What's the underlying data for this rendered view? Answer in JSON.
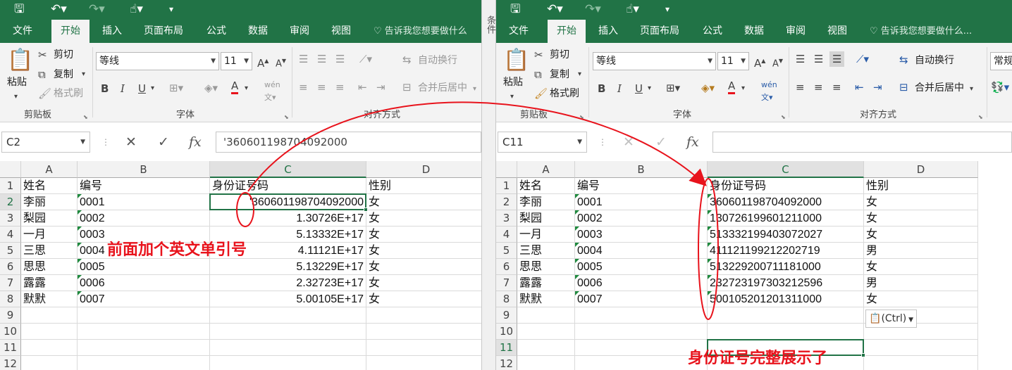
{
  "colors": {
    "excel_green": "#217346",
    "annotation_red": "#e8131c"
  },
  "left": {
    "quick_access": [
      "save-icon",
      "undo-icon",
      "redo-icon",
      "touch-mode-icon",
      "customize-icon"
    ],
    "tabs": [
      "文件",
      "开始",
      "插入",
      "页面布局",
      "公式",
      "数据",
      "审阅",
      "视图"
    ],
    "tell_me": "告诉我您想要做什么",
    "clipboard": {
      "paste": "粘贴",
      "cut": "剪切",
      "copy": "复制",
      "format_painter": "格式刷",
      "group": "剪贴板"
    },
    "font": {
      "name": "等线",
      "size": "11",
      "group": "字体"
    },
    "alignment": {
      "wrap": "自动换行",
      "merge": "合并后居中",
      "group": "对齐方式"
    },
    "name_box": "C2",
    "formula_value": "'360601198704092000",
    "columns": [
      "A",
      "B",
      "C",
      "D"
    ],
    "rows": [
      "1",
      "2",
      "3",
      "4",
      "5",
      "6",
      "7",
      "8",
      "9",
      "10",
      "11",
      "12"
    ],
    "cells": [
      [
        "姓名",
        "编号",
        "身份证号码",
        "性别"
      ],
      [
        "李丽",
        "0001",
        "'360601198704092000",
        "女"
      ],
      [
        "梨园",
        "0002",
        "1.30726E+17",
        "女"
      ],
      [
        "一月",
        "0003",
        "5.13332E+17",
        "女"
      ],
      [
        "三思",
        "0004",
        "4.11121E+17",
        "女"
      ],
      [
        "思思",
        "0005",
        "5.13229E+17",
        "女"
      ],
      [
        "露露",
        "0006",
        "2.32723E+17",
        "女"
      ],
      [
        "默默",
        "0007",
        "5.00105E+17",
        "女"
      ]
    ],
    "annotation": "前面加个英文单引号"
  },
  "divider_fragment": "条件",
  "right": {
    "tabs": [
      "文件",
      "开始",
      "插入",
      "页面布局",
      "公式",
      "数据",
      "审阅",
      "视图"
    ],
    "tell_me": "告诉我您想要做什么...",
    "clipboard": {
      "paste": "粘贴",
      "cut": "剪切",
      "copy": "复制",
      "format_painter": "格式刷",
      "group": "剪贴板"
    },
    "font": {
      "name": "等线",
      "size": "11",
      "group": "字体"
    },
    "alignment": {
      "wrap": "自动换行",
      "merge": "合并后居中",
      "group": "对齐方式"
    },
    "number_format": "常规",
    "name_box": "C11",
    "formula_value": "",
    "columns": [
      "A",
      "B",
      "C",
      "D"
    ],
    "rows": [
      "1",
      "2",
      "3",
      "4",
      "5",
      "6",
      "7",
      "8",
      "9",
      "10",
      "11",
      "12"
    ],
    "cells": [
      [
        "姓名",
        "编号",
        "身份证号码",
        "性别"
      ],
      [
        "李丽",
        "0001",
        "360601198704092000",
        "女"
      ],
      [
        "梨园",
        "0002",
        "130726199601211000",
        "女"
      ],
      [
        "一月",
        "0003",
        "513332199403072027",
        "女"
      ],
      [
        "三思",
        "0004",
        "411121199212202719",
        "男"
      ],
      [
        "思思",
        "0005",
        "513229200711181000",
        "女"
      ],
      [
        "露露",
        "0006",
        "232723197303212596",
        "男"
      ],
      [
        "默默",
        "0007",
        "500105201201311000",
        "女"
      ]
    ],
    "paste_options": "(Ctrl)",
    "annotation": "身份证号完整展示了"
  }
}
